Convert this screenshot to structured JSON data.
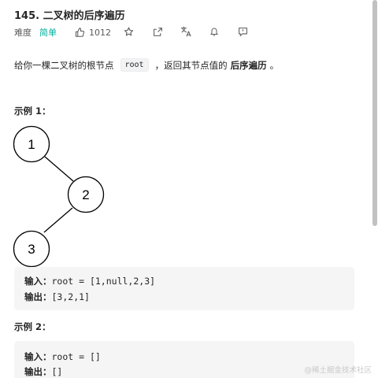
{
  "problem": {
    "title": "145. 二叉树的后序遍历",
    "difficulty_label": "难度",
    "difficulty": "简单",
    "likes": "1012",
    "description": {
      "prefix": "给你一棵二叉树的根节点",
      "code": "root",
      "middle": "，返回其节点值的",
      "bold": "后序遍历",
      "suffix": "。"
    }
  },
  "toolbar": {
    "icons": [
      "thumbs-up-icon",
      "star-icon",
      "share-icon",
      "translate-icon",
      "bell-icon",
      "comment-icon"
    ]
  },
  "example1": {
    "title": "示例 1：",
    "tree_nodes": [
      "1",
      "2",
      "3"
    ],
    "input_label": "输入：",
    "input_value": "root = [1,null,2,3]",
    "output_label": "输出：",
    "output_value": "[3,2,1]"
  },
  "example2": {
    "title": "示例 2：",
    "input_label": "输入：",
    "input_value": "root = []",
    "output_label": "输出：",
    "output_value": "[]"
  },
  "watermark": "@稀土掘金技术社区"
}
